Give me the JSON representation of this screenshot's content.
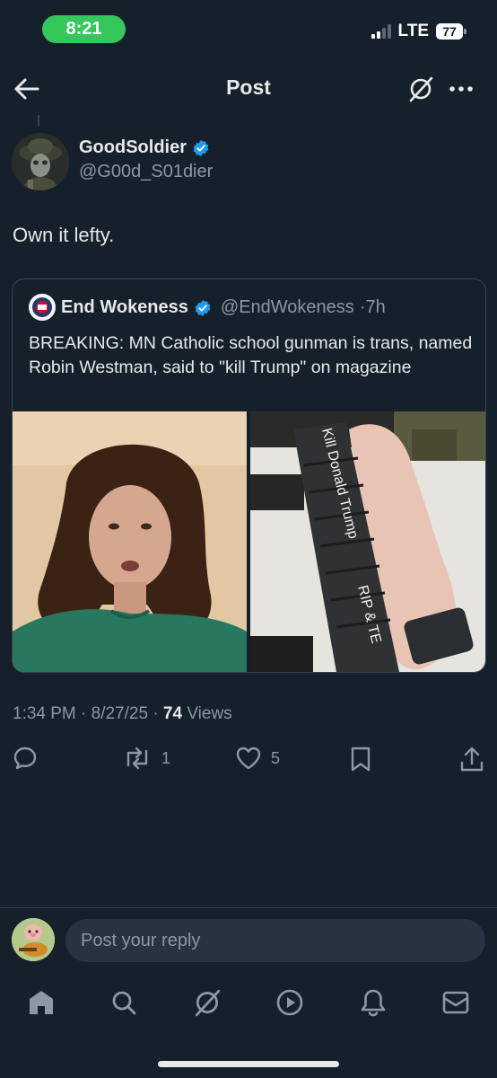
{
  "status_bar": {
    "time": "8:21",
    "network": "LTE",
    "battery": "77"
  },
  "header": {
    "title": "Post",
    "back_icon": "arrow-left-icon",
    "grok_icon": "grok-icon",
    "more_icon": "more-icon"
  },
  "post": {
    "author_name": "GoodSoldier",
    "author_handle": "@G00d_S01dier",
    "verified": true,
    "text": "Own it lefty.",
    "timestamp": "1:34 PM · 8/27/25 · ",
    "views_count": "74",
    "views_label": " Views"
  },
  "quote": {
    "author_name": "End Wokeness",
    "author_handle": "@EndWokeness",
    "age": "·7h",
    "text": "BREAKING: MN Catholic school gunman is trans, named Robin Westman, said to \"kill Trump\" on magazine",
    "magazine_writing": [
      "Kill Donald Trump",
      "RIP & TE"
    ]
  },
  "actions": {
    "reply": {
      "icon": "reply-icon",
      "count": ""
    },
    "repost": {
      "icon": "repost-icon",
      "count": "1"
    },
    "like": {
      "icon": "heart-icon",
      "count": "5"
    },
    "bookmark": {
      "icon": "bookmark-icon",
      "count": ""
    },
    "share": {
      "icon": "share-icon",
      "count": ""
    }
  },
  "reply_bar": {
    "placeholder": "Post your reply"
  },
  "tabbar": [
    "home-icon",
    "search-icon",
    "grok-icon",
    "video-icon",
    "bell-icon",
    "mail-icon"
  ],
  "colors": {
    "background": "#15202b",
    "verified": "#1d9bf0",
    "muted": "#8b98a5",
    "text": "#e7e9ea",
    "time_pill": "#34c759"
  }
}
